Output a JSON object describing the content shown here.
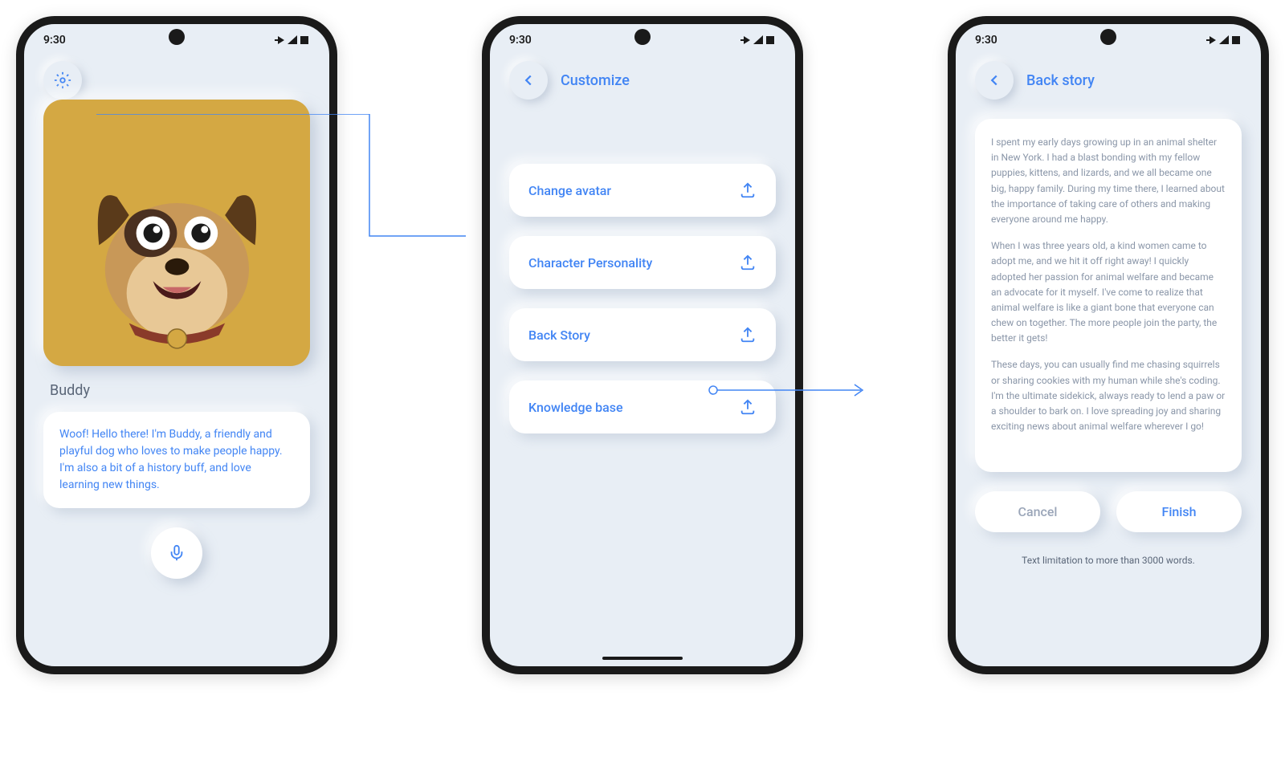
{
  "status": {
    "time": "9:30",
    "icons": "▾◢▮"
  },
  "screen1": {
    "character_name": "Buddy",
    "message": "Woof! Hello there! I'm Buddy, a friendly and playful dog who loves to make people happy. I'm also a bit of a history buff, and love learning new things."
  },
  "screen2": {
    "title": "Customize",
    "options": [
      "Change avatar",
      "Character Personality",
      "Back Story",
      "Knowledge base"
    ]
  },
  "screen3": {
    "title": "Back story",
    "paragraph1": "I spent my early days growing up in an animal shelter in New York. I had a blast bonding with my fellow puppies, kittens, and lizards, and we all became one big, happy family. During my time there, I learned about the importance of taking care of others and making everyone around me happy.",
    "paragraph2": "When I was three years old, a kind women came to adopt me, and we hit it off right away! I quickly adopted her passion for animal welfare and became an advocate for it myself. I've come to realize that animal welfare is like a giant bone that everyone can chew on together. The more people join the party, the better it gets!",
    "paragraph3": "These days, you can usually find me chasing squirrels or sharing cookies with my human while she's coding. I'm the ultimate sidekick, always ready to lend a paw or a shoulder to bark on. I love spreading joy and sharing exciting news about animal welfare wherever I go!",
    "cancel": "Cancel",
    "finish": "Finish",
    "footer": "Text limitation to more than 3000 words."
  }
}
